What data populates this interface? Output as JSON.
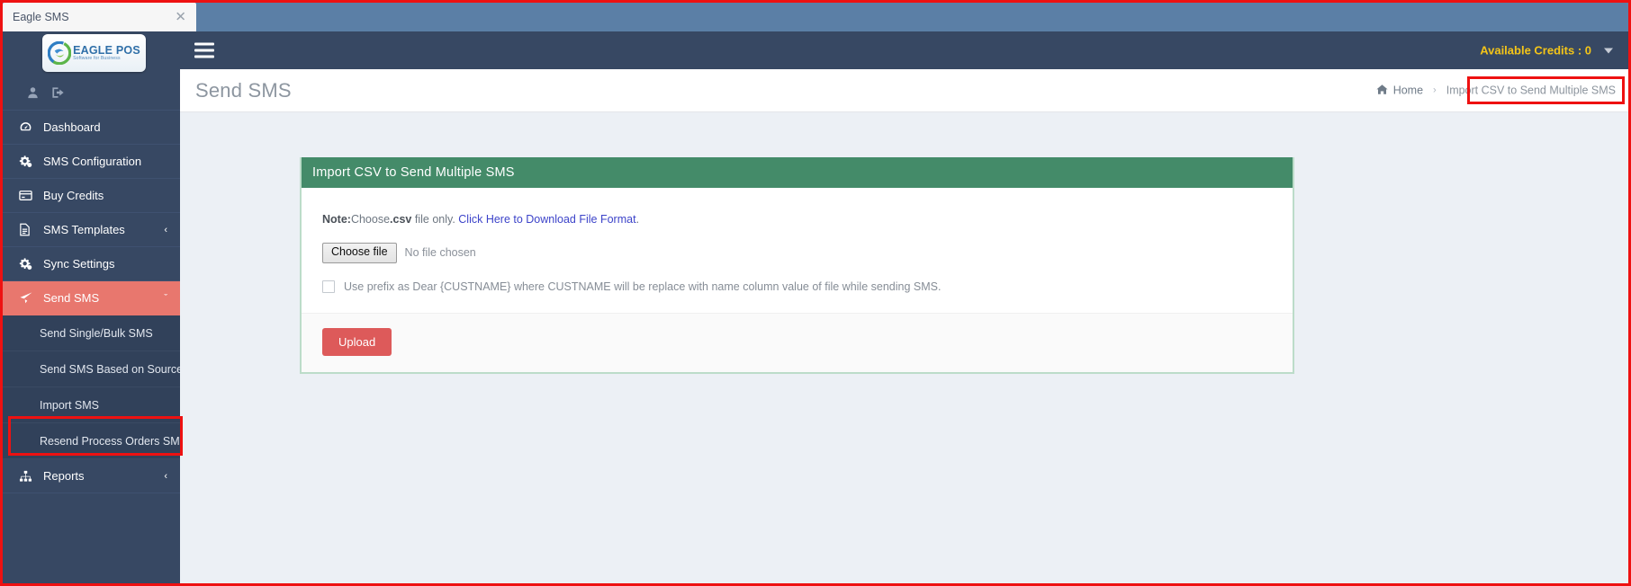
{
  "browser": {
    "tab_title": "Eagle SMS",
    "close_icon": "close-icon"
  },
  "sidebar": {
    "logo": {
      "title": "EAGLE POS",
      "subtitle": "Software for Business",
      "icon": "eagle-logo-icon"
    },
    "user_icons": [
      {
        "name": "user-icon"
      },
      {
        "name": "logout-icon"
      }
    ],
    "items": [
      {
        "label": "Dashboard",
        "icon": "dashboard-icon",
        "active": false,
        "caret": ""
      },
      {
        "label": "SMS Configuration",
        "icon": "gears-icon",
        "active": false,
        "caret": ""
      },
      {
        "label": "Buy Credits",
        "icon": "credit-card-icon",
        "active": false,
        "caret": ""
      },
      {
        "label": "SMS Templates",
        "icon": "document-icon",
        "active": false,
        "caret": "‹"
      },
      {
        "label": "Sync Settings",
        "icon": "gears-icon",
        "active": false,
        "caret": ""
      },
      {
        "label": "Send SMS",
        "icon": "paper-plane-icon",
        "active": true,
        "caret": "ˇ"
      }
    ],
    "submenu": [
      {
        "label": "Send Single/Bulk SMS"
      },
      {
        "label": "Send SMS Based on Source"
      },
      {
        "label": "Import SMS",
        "highlighted": true
      },
      {
        "label": "Resend Process Orders SMS"
      }
    ],
    "items_after": [
      {
        "label": "Reports",
        "icon": "sitemap-icon",
        "active": false,
        "caret": "‹"
      }
    ]
  },
  "navbar": {
    "hamburger_icon": "hamburger-icon",
    "credits_label": "Available Credits : 0",
    "caret_icon": "chevron-down-icon"
  },
  "header": {
    "page_title": "Send SMS",
    "breadcrumb": {
      "home_icon": "home-icon",
      "home_label": "Home",
      "separator": "›",
      "current": "Import CSV to Send Multiple SMS"
    }
  },
  "card": {
    "title": "Import CSV to Send Multiple SMS",
    "note": {
      "label": "Note:",
      "text_before": "Choose",
      "csv": ".csv",
      "text_after": " file only. ",
      "link": "Click Here to Download File Format",
      "period": "."
    },
    "file_input": {
      "button_label": "Choose file",
      "status": "No file chosen"
    },
    "checkbox": {
      "checked": false,
      "label": "Use prefix as Dear {CUSTNAME} where CUSTNAME will be replace with name column value of file while sending SMS."
    },
    "upload_button": "Upload"
  },
  "colors": {
    "sidebar_bg": "#374863",
    "sidebar_active": "#e8776e",
    "submenu_bg": "#31415a",
    "navbar_bg": "#374863",
    "card_header_green": "#448b69",
    "card_border_green": "#bcdcc9",
    "credits_yellow": "#f4c518",
    "upload_red": "#dd5a5a",
    "link_blue": "#3c43c9",
    "annotation_red": "#ee1111",
    "browser_bar_blue": "#5b7fa6",
    "content_bg": "#ecf0f5"
  }
}
